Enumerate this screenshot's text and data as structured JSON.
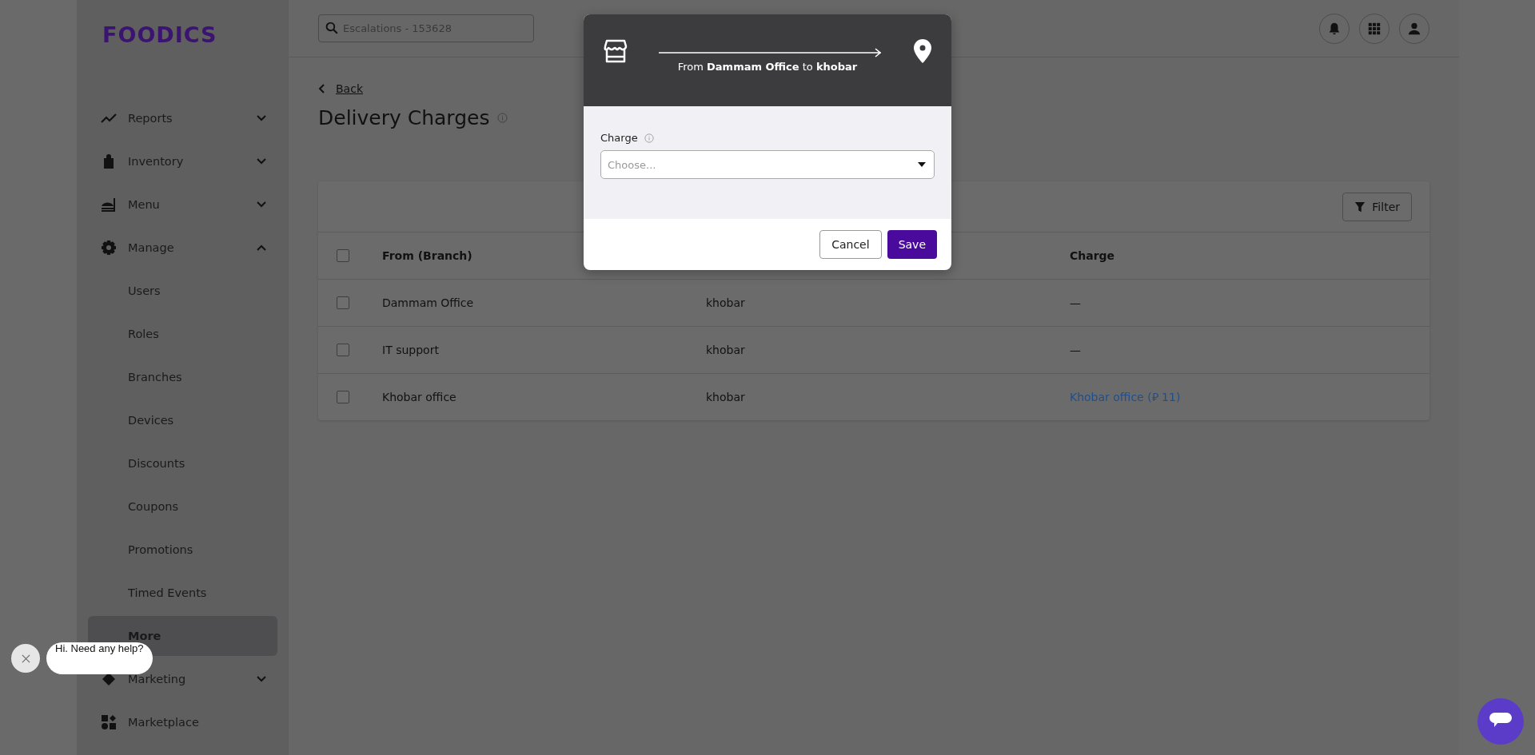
{
  "sidebar": {
    "logo": "FOODICS",
    "items": [
      {
        "label": "Reports",
        "kind": "group",
        "expanded": false,
        "selected": false
      },
      {
        "label": "Inventory",
        "kind": "group",
        "expanded": false,
        "selected": false
      },
      {
        "label": "Menu",
        "kind": "group",
        "expanded": false,
        "selected": false
      },
      {
        "label": "Manage",
        "kind": "group",
        "expanded": true,
        "selected": false
      },
      {
        "label": "Users",
        "kind": "sub",
        "selected": false
      },
      {
        "label": "Roles",
        "kind": "sub",
        "selected": false
      },
      {
        "label": "Branches",
        "kind": "sub",
        "selected": false
      },
      {
        "label": "Devices",
        "kind": "sub",
        "selected": false
      },
      {
        "label": "Discounts",
        "kind": "sub",
        "selected": false
      },
      {
        "label": "Coupons",
        "kind": "sub",
        "selected": false
      },
      {
        "label": "Promotions",
        "kind": "sub",
        "selected": false
      },
      {
        "label": "Timed Events",
        "kind": "sub",
        "selected": false
      },
      {
        "label": "More",
        "kind": "sub",
        "selected": true
      },
      {
        "label": "Marketing",
        "kind": "group",
        "expanded": false,
        "selected": false
      },
      {
        "label": "Marketplace",
        "kind": "link",
        "selected": false
      }
    ]
  },
  "topbar": {
    "search": {
      "placeholder": "Escalations - 153628"
    }
  },
  "page": {
    "back": "Back",
    "title": "Delivery Charges",
    "filter": "Filter",
    "table": {
      "all_selected": false,
      "columns": [
        "From (Branch)",
        "",
        "Charge"
      ],
      "rows": [
        {
          "selected": false,
          "from": "Dammam Office",
          "to": "khobar",
          "charge": "—",
          "charge_link": false
        },
        {
          "selected": false,
          "from": "IT support",
          "to": "khobar",
          "charge": "—",
          "charge_link": false
        },
        {
          "selected": false,
          "from": "Khobar office",
          "to": "khobar",
          "charge": "Khobar office (⃁ 11)",
          "charge_link": true
        }
      ]
    }
  },
  "modal": {
    "route": "From **Dammam Office** to **khobar**",
    "field_label": "Charge",
    "placeholder": "Choose...",
    "buttons": [
      "Cancel",
      "Save"
    ]
  },
  "chat": {
    "greeting": "Hi. Need any help?"
  }
}
